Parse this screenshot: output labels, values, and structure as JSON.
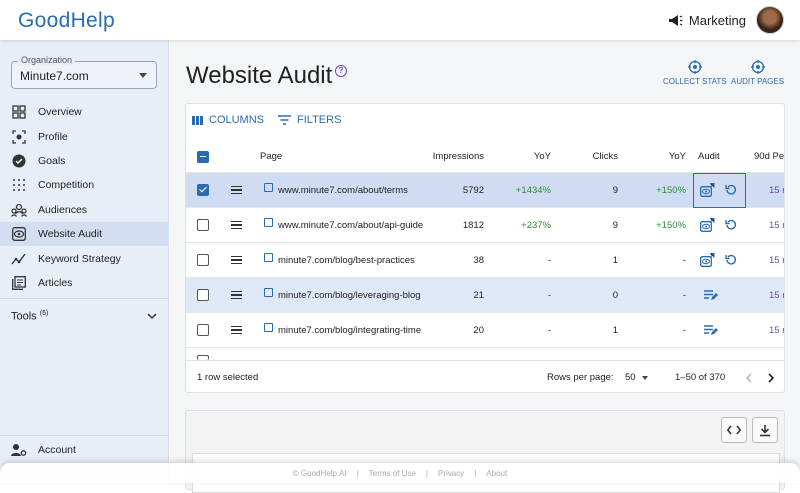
{
  "brand": {
    "logo": "GoodHelp"
  },
  "header": {
    "team": "Marketing",
    "team_icon": "megaphone-icon"
  },
  "sidebar": {
    "org_label": "Organization",
    "org_value": "Minute7.com",
    "items": [
      {
        "label": "Overview",
        "icon": "grid-icon"
      },
      {
        "label": "Profile",
        "icon": "profile-icon"
      },
      {
        "label": "Goals",
        "icon": "check-circle-icon"
      },
      {
        "label": "Competition",
        "icon": "dots-grid-icon"
      },
      {
        "label": "Audiences",
        "icon": "audience-icon"
      },
      {
        "label": "Website Audit",
        "icon": "eye-icon",
        "active": true
      },
      {
        "label": "Keyword Strategy",
        "icon": "chart-icon"
      },
      {
        "label": "Articles",
        "icon": "articles-icon"
      }
    ],
    "tools_label": "Tools",
    "tools_count": "(6)",
    "account_label": "Account"
  },
  "page": {
    "title": "Website Audit",
    "actions": {
      "collect": "COLLECT STATS",
      "audit": "AUDIT PAGES"
    }
  },
  "grid": {
    "toolbar": {
      "columns": "COLUMNS",
      "filters": "FILTERS"
    },
    "headers": {
      "page": "Page",
      "impressions": "Impressions",
      "yoy1": "YoY",
      "clicks": "Clicks",
      "yoy2": "YoY",
      "audit": "Audit",
      "p90": "90d Pe"
    },
    "rows": [
      {
        "page": "www.minute7.com/about/terms",
        "impressions": "5792",
        "yoy1": "+1434%",
        "clicks": "9",
        "yoy2": "+150%",
        "p90": "15 r",
        "selected": true
      },
      {
        "page": "www.minute7.com/about/api-guide",
        "impressions": "1812",
        "yoy1": "+237%",
        "clicks": "9",
        "yoy2": "+150%",
        "p90": "15 r"
      },
      {
        "page": "minute7.com/blog/best-practices",
        "impressions": "38",
        "yoy1": "-",
        "clicks": "1",
        "yoy2": "-",
        "p90": "15 r"
      },
      {
        "page": "minute7.com/blog/leveraging-blog",
        "impressions": "21",
        "yoy1": "-",
        "clicks": "0",
        "yoy2": "-",
        "p90": "15 r"
      },
      {
        "page": "minute7.com/blog/integrating-time",
        "impressions": "20",
        "yoy1": "-",
        "clicks": "1",
        "yoy2": "-",
        "p90": "15 r"
      }
    ],
    "footer": {
      "selected": "1 row selected",
      "rows_per_page_label": "Rows per page:",
      "rows_per_page": "50",
      "range": "1–50 of 370"
    }
  },
  "footer": {
    "copyright": "© GoodHelp.AI",
    "terms": "Terms of Use",
    "privacy": "Privacy",
    "about": "About",
    "divider": "|"
  },
  "colors": {
    "accent": "#2b6cb0",
    "green": "#2f8a3b",
    "purple": "#6b46c1",
    "selected_row": "#cfdcf1"
  }
}
